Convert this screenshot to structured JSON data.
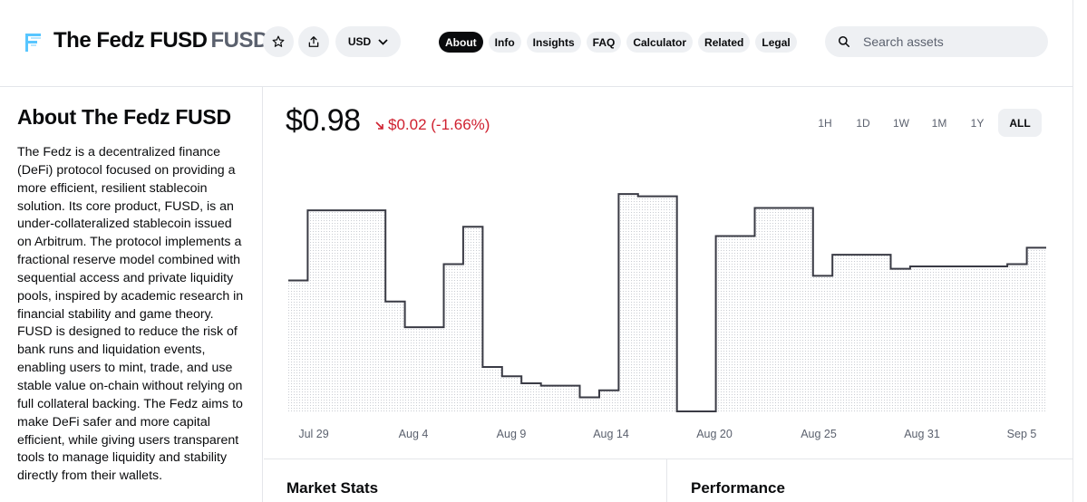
{
  "header": {
    "asset_name": "The Fedz FUSD",
    "asset_symbol": "FUSD",
    "currency": "USD",
    "tabs": [
      {
        "label": "About",
        "active": true
      },
      {
        "label": "Info",
        "active": false
      },
      {
        "label": "Insights",
        "active": false
      },
      {
        "label": "FAQ",
        "active": false
      },
      {
        "label": "Calculator",
        "active": false
      },
      {
        "label": "Related",
        "active": false
      },
      {
        "label": "Legal",
        "active": false
      }
    ],
    "search_placeholder": "Search assets",
    "icons": {
      "logo": "fedz-logo-icon",
      "star": "star-icon",
      "share": "share-icon",
      "chevron": "chevron-down-icon",
      "search": "search-icon"
    }
  },
  "about": {
    "heading": "About The Fedz FUSD",
    "body": "The Fedz is a decentralized finance (DeFi) protocol focused on providing a more efficient, resilient stablecoin solution. Its core product, FUSD, is an under-collateralized stablecoin issued on Arbitrum. The protocol implements a fractional reserve model combined with sequential access and private liquidity pools, inspired by academic research in financial stability and game theory. FUSD is designed to reduce the risk of bank runs and liquidation events, enabling users to mint, trade, and use stable value on-chain without relying on full collateral backing. The Fedz aims to make DeFi safer and more capital efficient, while giving users transparent tools to manage liquidity and stability directly from their wallets."
  },
  "price": {
    "value": "$0.98",
    "change": "$0.02 (-1.66%)",
    "change_color": "#cf202f"
  },
  "ranges": [
    {
      "label": "1H",
      "active": false
    },
    {
      "label": "1D",
      "active": false
    },
    {
      "label": "1W",
      "active": false
    },
    {
      "label": "1M",
      "active": false
    },
    {
      "label": "1Y",
      "active": false
    },
    {
      "label": "ALL",
      "active": true
    }
  ],
  "chart_data": {
    "type": "line",
    "x_ticks": [
      "Jul 29",
      "Aug 4",
      "Aug 9",
      "Aug 14",
      "Aug 20",
      "Aug 25",
      "Aug 31",
      "Sep 5"
    ],
    "points": [
      [
        0,
        0.56
      ],
      [
        1,
        0.56
      ],
      [
        1,
        0.86
      ],
      [
        5,
        0.86
      ],
      [
        5,
        0.47
      ],
      [
        6,
        0.47
      ],
      [
        6,
        0.36
      ],
      [
        8,
        0.36
      ],
      [
        8,
        0.63
      ],
      [
        9,
        0.63
      ],
      [
        9,
        0.79
      ],
      [
        10,
        0.79
      ],
      [
        10,
        0.19
      ],
      [
        11,
        0.19
      ],
      [
        11,
        0.15
      ],
      [
        12,
        0.15
      ],
      [
        12,
        0.12
      ],
      [
        13,
        0.12
      ],
      [
        13,
        0.11
      ],
      [
        15,
        0.11
      ],
      [
        15,
        0.06
      ],
      [
        16,
        0.06
      ],
      [
        16,
        0.09
      ],
      [
        17,
        0.09
      ],
      [
        17,
        0.93
      ],
      [
        18,
        0.93
      ],
      [
        18,
        0.92
      ],
      [
        20,
        0.92
      ],
      [
        20,
        0.0
      ],
      [
        22,
        0.0
      ],
      [
        22,
        0.75
      ],
      [
        24,
        0.75
      ],
      [
        24,
        0.87
      ],
      [
        27,
        0.87
      ],
      [
        27,
        0.58
      ],
      [
        28,
        0.58
      ],
      [
        28,
        0.67
      ],
      [
        31,
        0.67
      ],
      [
        31,
        0.61
      ],
      [
        32,
        0.61
      ],
      [
        32,
        0.62
      ],
      [
        37,
        0.62
      ],
      [
        37,
        0.63
      ],
      [
        38,
        0.63
      ],
      [
        38,
        0.7
      ],
      [
        39,
        0.7
      ]
    ],
    "line_color": "#3a3b45"
  },
  "panels": {
    "market_stats": "Market Stats",
    "performance": "Performance"
  }
}
